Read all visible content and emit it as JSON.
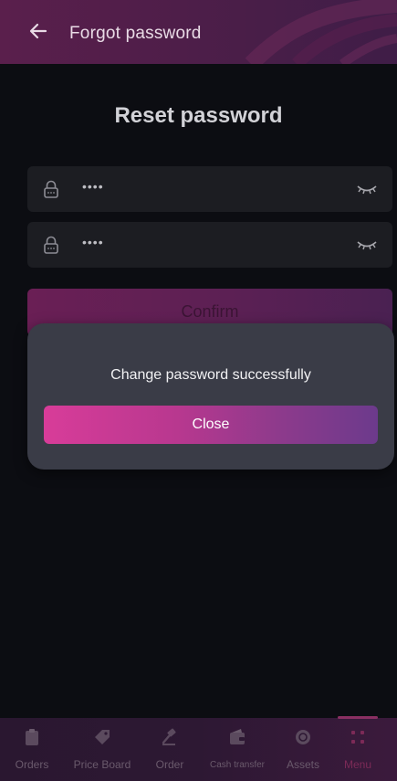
{
  "header": {
    "title": "Forgot password",
    "back_icon": "arrow-left-icon"
  },
  "screen": {
    "title": "Reset password"
  },
  "fields": [
    {
      "value": "••••",
      "lock_icon": "lock-icon",
      "toggle_icon": "eye-closed-icon"
    },
    {
      "value": "••••",
      "lock_icon": "lock-icon",
      "toggle_icon": "eye-closed-icon"
    }
  ],
  "confirm_label": "Confirm",
  "dialog": {
    "message": "Change password successfully",
    "close_label": "Close"
  },
  "nav": {
    "items": [
      {
        "label": "Orders",
        "icon": "clipboard-icon"
      },
      {
        "label": "Price Board",
        "icon": "tag-icon"
      },
      {
        "label": "Order",
        "icon": "hammer-icon"
      },
      {
        "label": "Cash transfer",
        "icon": "wallet-icon"
      },
      {
        "label": "Assets",
        "icon": "coins-icon"
      },
      {
        "label": "Menu",
        "icon": "grid-icon",
        "active": true
      }
    ]
  },
  "colors": {
    "accent_start": "#d83c99",
    "accent_end": "#6c3a8c",
    "background": "#0c0d12",
    "dialog": "#3a3c47"
  }
}
